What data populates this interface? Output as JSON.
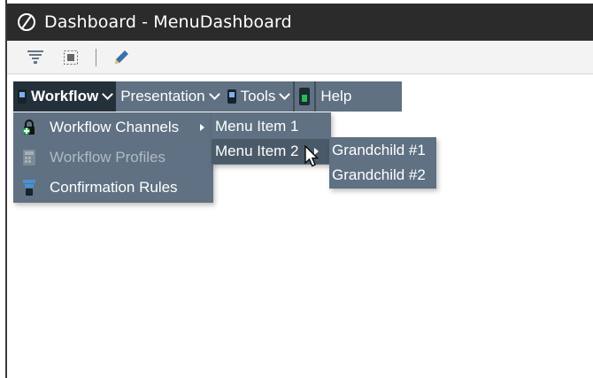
{
  "window": {
    "title": "Dashboard - MenuDashboard",
    "app_icon": "app-logo-icon"
  },
  "toolbar": {
    "buttons": [
      {
        "icon": "filter-icon"
      },
      {
        "icon": "select-all-icon"
      },
      {
        "icon": "pencil-icon"
      }
    ]
  },
  "menubar": {
    "items": [
      {
        "label": "Workflow",
        "icon": "calculator-icon",
        "active": true
      },
      {
        "label": "Presentation"
      },
      {
        "label": "Tools",
        "icon": "tools-icon"
      },
      {
        "label": "",
        "icon": "green-device-icon"
      },
      {
        "label": "Help"
      }
    ]
  },
  "workflow_menu": {
    "items": [
      {
        "label": "Workflow Channels",
        "icon": "lock-add-icon",
        "has_submenu": true,
        "disabled": false
      },
      {
        "label": "Workflow Profiles",
        "icon": "calculator-icon",
        "has_submenu": false,
        "disabled": true
      },
      {
        "label": "Confirmation Rules",
        "icon": "funnel-icon",
        "has_submenu": false,
        "disabled": false
      }
    ]
  },
  "channels_submenu": {
    "items": [
      {
        "label": "Menu Item 1",
        "has_submenu": false
      },
      {
        "label": "Menu Item 2",
        "has_submenu": true,
        "hovered": true
      }
    ]
  },
  "grandchild_submenu": {
    "items": [
      {
        "label": "Grandchild #1"
      },
      {
        "label": "Grandchild #2"
      }
    ]
  },
  "colors": {
    "menu_bg": "#5f7182",
    "menu_active_bg": "#24303a",
    "titlebar_bg": "#2b2b2b",
    "toolbar_bg": "#f3f3f3",
    "disabled_text": "#b0bac3"
  }
}
